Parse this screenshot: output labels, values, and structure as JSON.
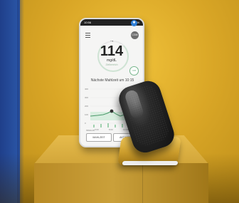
{
  "status": {
    "time": "10:56",
    "battery": "100 %"
  },
  "header": {
    "badge_icon": "bluetooth-icon",
    "cgm_chip": "CGM"
  },
  "glucose": {
    "trend_arrow": "→",
    "value": "114",
    "unit": "mg/dL",
    "range_text": "Zielbereich"
  },
  "insulin_chip": "IOB",
  "next_meal": "Nächste Mahlzeit um 10:15",
  "chart": {
    "y_ticks": [
      "400",
      "300",
      "200",
      "100",
      "0"
    ],
    "x_ticks": [
      "6:00",
      "8:00",
      "10:00"
    ],
    "mini_label": "INSULIN"
  },
  "actions": {
    "meal_label": "MAHLZEIT",
    "activity_label": "AKTIVITÄT"
  },
  "colors": {
    "accent_blue": "#2f7fd6",
    "target_band": "#d8eedf",
    "line": "#4a9a69"
  }
}
